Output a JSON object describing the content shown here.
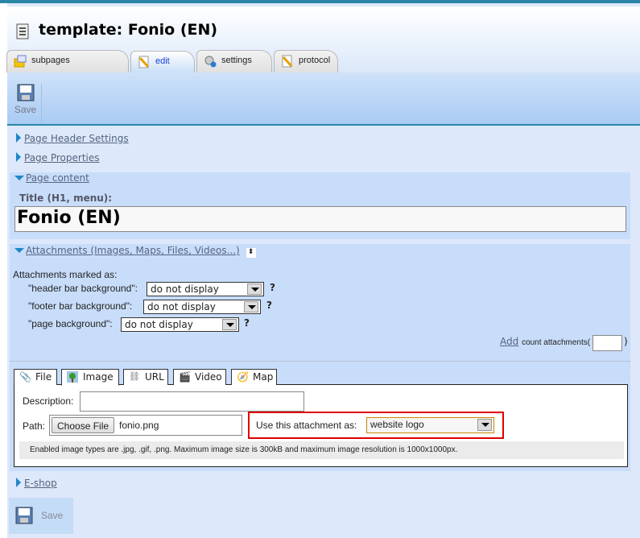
{
  "header": {
    "title": "template: Fonio (EN)",
    "icon": "template-page-icon"
  },
  "tabs": [
    {
      "label": "subpages",
      "icon": "folder-icon"
    },
    {
      "label": "edit",
      "icon": "pencil-icon",
      "active": true
    },
    {
      "label": "settings",
      "icon": "gear-icon"
    },
    {
      "label": "protocol",
      "icon": "pencil-icon"
    }
  ],
  "toolbar": {
    "save_label": "Save"
  },
  "sections": {
    "page_header_settings": "Page Header Settings",
    "page_properties": "Page Properties",
    "page_content": "Page content",
    "attachments": "Attachments (Images, Maps, Files, Videos...)",
    "eshop": "E-shop"
  },
  "page_content": {
    "title_label": "Title (H1, menu):",
    "title_value": "Fonio (EN)"
  },
  "attachments": {
    "marked_as_label": "Attachments marked as:",
    "rows": [
      {
        "label": "\"header bar background\":",
        "value": "do not display",
        "help": "?"
      },
      {
        "label": "\"footer bar background\":",
        "value": "do not display",
        "help": "?"
      },
      {
        "label": "\"page background\":",
        "value": "do not display",
        "help": "?"
      }
    ],
    "add_link": "Add",
    "count_label": "count attachments(",
    "count_close": ")",
    "count_value": "",
    "tabs": [
      {
        "label": "File",
        "icon": "paperclip-icon"
      },
      {
        "label": "Image",
        "icon": "image-icon",
        "active": true
      },
      {
        "label": "URL",
        "icon": "link-icon"
      },
      {
        "label": "Video",
        "icon": "clapperboard-icon"
      },
      {
        "label": "Map",
        "icon": "compass-icon"
      }
    ],
    "description_label": "Description:",
    "description_value": "",
    "path_label": "Path:",
    "choose_file": "Choose File",
    "file_name": "fonio.png",
    "use_as_label": "Use this attachment as:",
    "use_as_value": "website logo",
    "info": "Enabled image types are .jpg, .gif, .png. Maximum image size is 300kB and maximum image resolution is 1000x1000px."
  },
  "footer": {
    "save_label": "Save"
  },
  "colors": {
    "accent": "#2a86a6",
    "highlight_box": "#e00000",
    "panel": "#c8ddfa",
    "link": "#55657e"
  }
}
